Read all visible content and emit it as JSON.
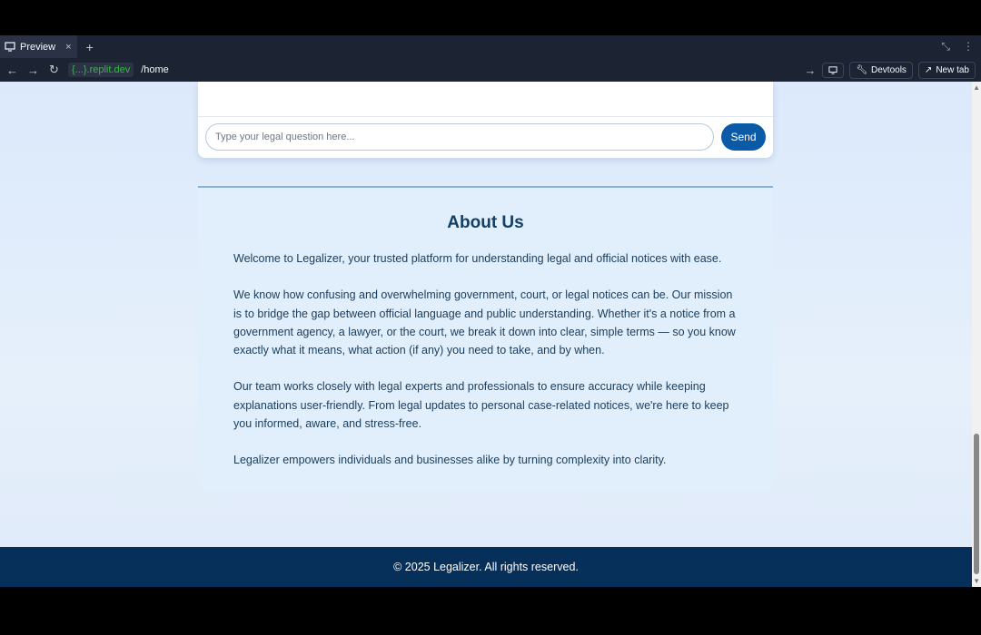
{
  "browser": {
    "tab_label": "Preview",
    "tab_close": "×",
    "new_tab_symbol": "+",
    "domain": "{...}.replit.dev",
    "path": "/home",
    "devtools_label": "Devtools",
    "newtab_label": "New tab"
  },
  "chat": {
    "input_placeholder": "Type your legal question here...",
    "send_label": "Send"
  },
  "about": {
    "title": "About Us",
    "paragraphs": [
      "Welcome to Legalizer, your trusted platform for understanding legal and official notices with ease.",
      "We know how confusing and overwhelming government, court, or legal notices can be. Our mission is to bridge the gap between official language and public understanding. Whether it's a notice from a government agency, a lawyer, or the court, we break it down into clear, simple terms — so you know exactly what it means, what action (if any) you need to take, and by when.",
      "Our team works closely with legal experts and professionals to ensure accuracy while keeping explanations user-friendly. From legal updates to personal case-related notices, we're here to keep you informed, aware, and stress-free.",
      "Legalizer empowers individuals and businesses alike by turning complexity into clarity."
    ]
  },
  "footer": {
    "text": "© 2025 Legalizer. All rights reserved."
  }
}
